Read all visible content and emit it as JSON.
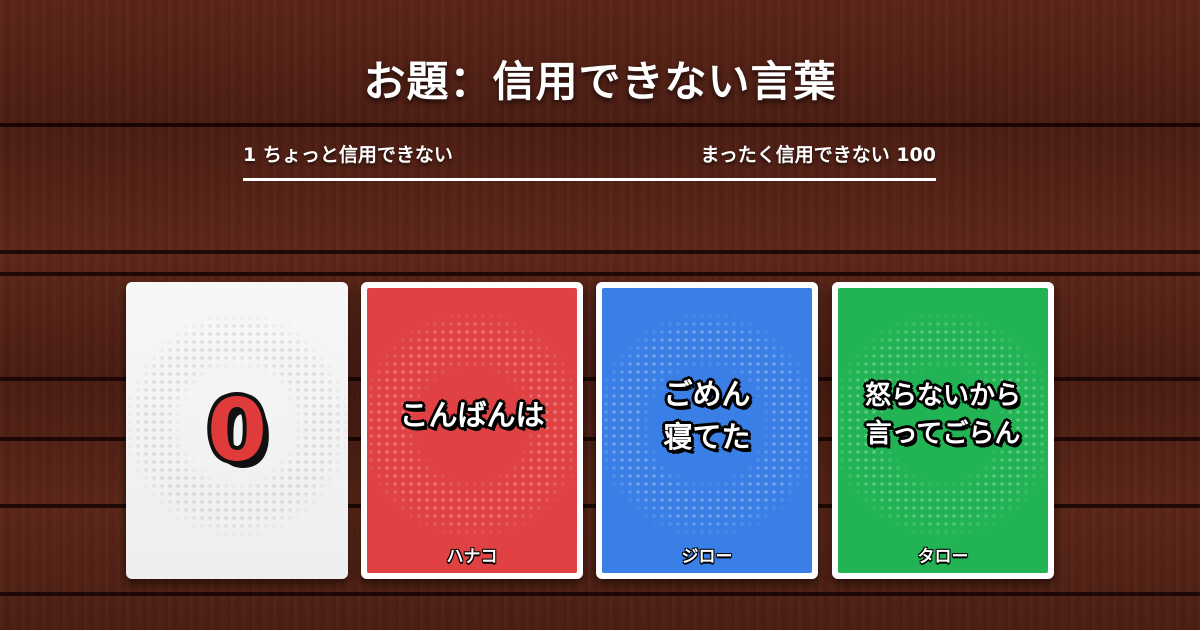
{
  "title": "お題：信用できない言葉",
  "scale": {
    "left_label": "1 ちょっと信用できない",
    "right_label": "まったく信用できない 100"
  },
  "target_card": {
    "value": "0",
    "color": "#e03b3b"
  },
  "cards": [
    {
      "text": "こんばんは",
      "player": "ハナコ",
      "color": "#e04244"
    },
    {
      "text": "ごめん\n寝てた",
      "player": "ジロー",
      "color": "#3a7fe6"
    },
    {
      "text": "怒らないから\n言ってごらん",
      "player": "タロー",
      "color": "#22b454"
    }
  ]
}
